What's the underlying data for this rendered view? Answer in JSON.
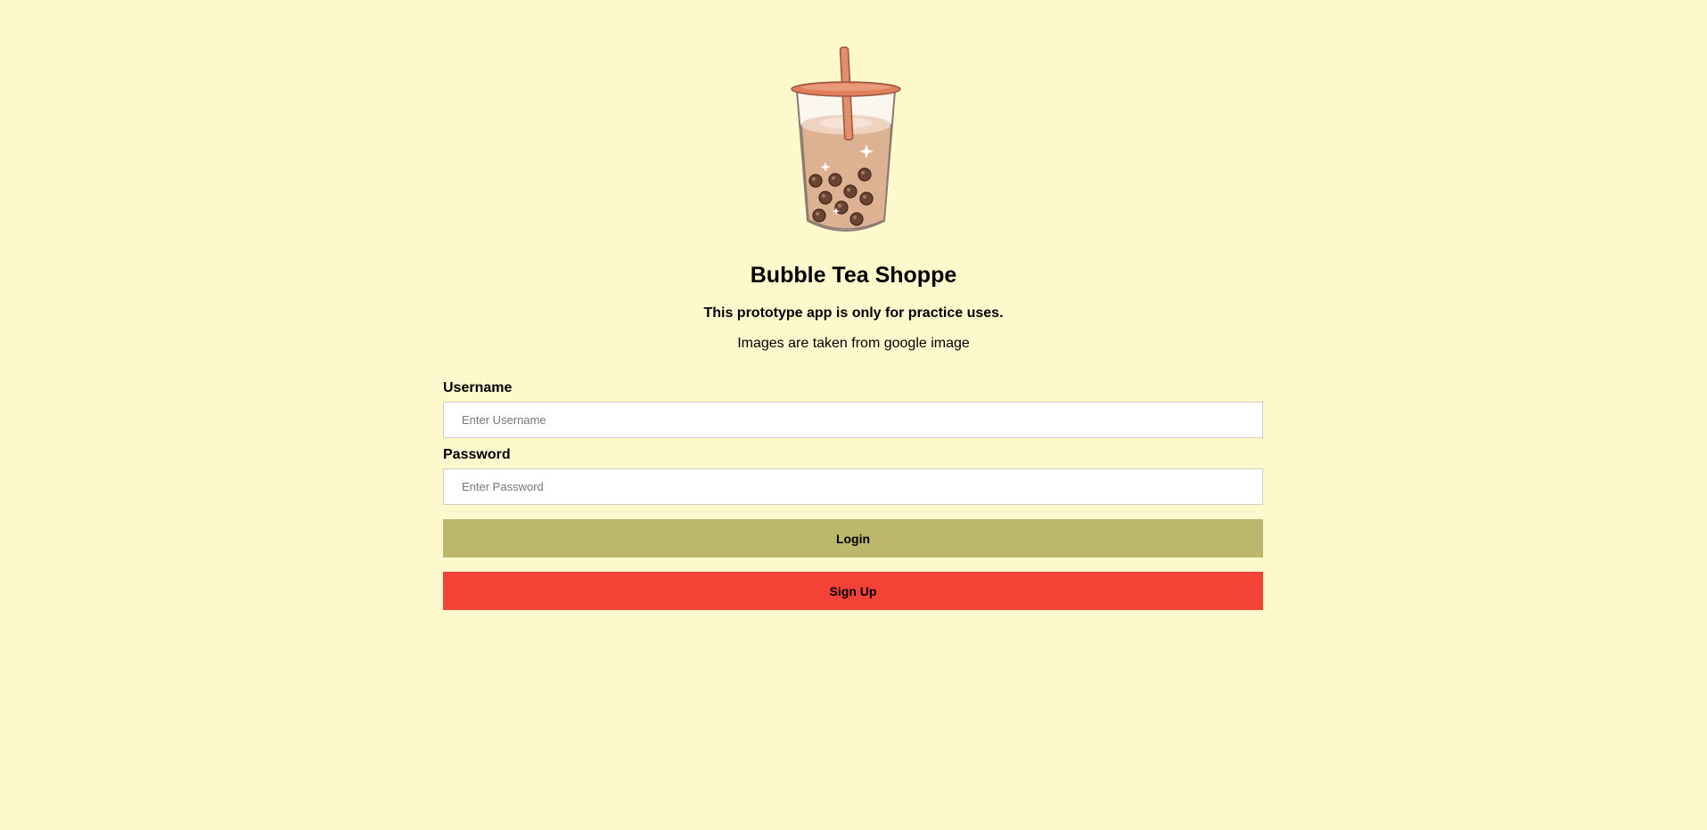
{
  "app": {
    "title": "Bubble Tea Shoppe",
    "subtitle": "This prototype app is only for practice uses.",
    "note": "Images are taken from google image",
    "logo_icon": "bubble-tea-icon"
  },
  "form": {
    "username_label": "Username",
    "username_placeholder": "Enter Username",
    "username_value": "",
    "password_label": "Password",
    "password_placeholder": "Enter Password",
    "password_value": "",
    "login_label": "Login",
    "signup_label": "Sign Up"
  },
  "colors": {
    "background": "#fef9cd",
    "login_button": "#bdb76b",
    "signup_button": "#f44336"
  }
}
